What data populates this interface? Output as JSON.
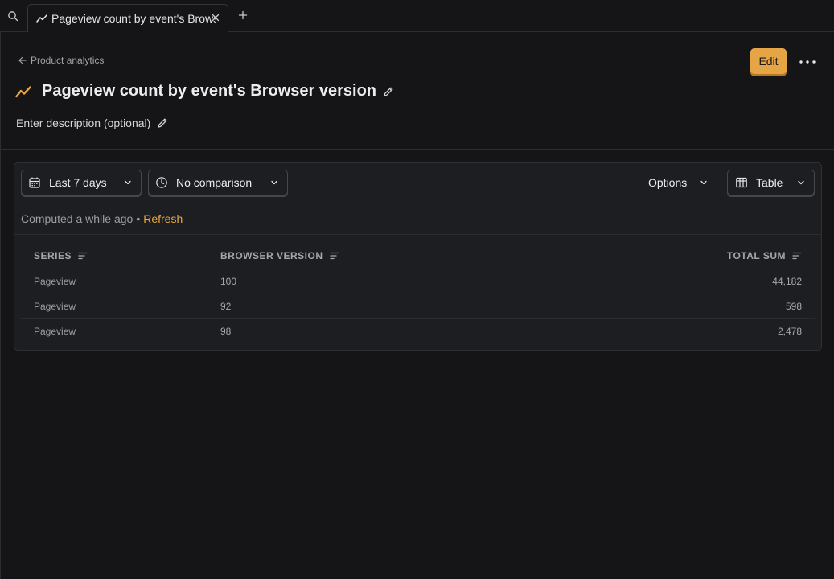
{
  "tab": {
    "title": "Pageview count by event's Browser version"
  },
  "breadcrumb": {
    "label": "Product analytics"
  },
  "header": {
    "edit_label": "Edit",
    "title": "Pageview count by event's Browser version",
    "description": "Enter description (optional)"
  },
  "toolbar": {
    "date_range": "Last 7 days",
    "comparison": "No comparison",
    "options_label": "Options",
    "display_type": "Table"
  },
  "status": {
    "computed": "Computed a while ago",
    "separator": "•",
    "refresh": "Refresh"
  },
  "table": {
    "columns": [
      "SERIES",
      "BROWSER VERSION",
      "TOTAL SUM"
    ],
    "rows": [
      [
        "Pageview",
        "100",
        "44,182"
      ],
      [
        "Pageview",
        "92",
        "598"
      ],
      [
        "Pageview",
        "98",
        "2,478"
      ]
    ]
  },
  "colors": {
    "accent": "#e6a545",
    "refresh_link": "#e9a83d",
    "background": "#151518",
    "card": "#1d1e22"
  },
  "icons": {
    "search": "search-icon",
    "tab_trend": "trend-icon",
    "close": "close-icon",
    "add": "plus-icon",
    "back": "arrow-left-icon",
    "more": "more-horizontal-icon",
    "title": "trend-icon",
    "edit": "pencil-icon",
    "calendar": "calendar-icon",
    "clock": "clock-icon",
    "chevron": "chevron-down-icon",
    "table": "table-icon",
    "sort": "sort-icon"
  }
}
